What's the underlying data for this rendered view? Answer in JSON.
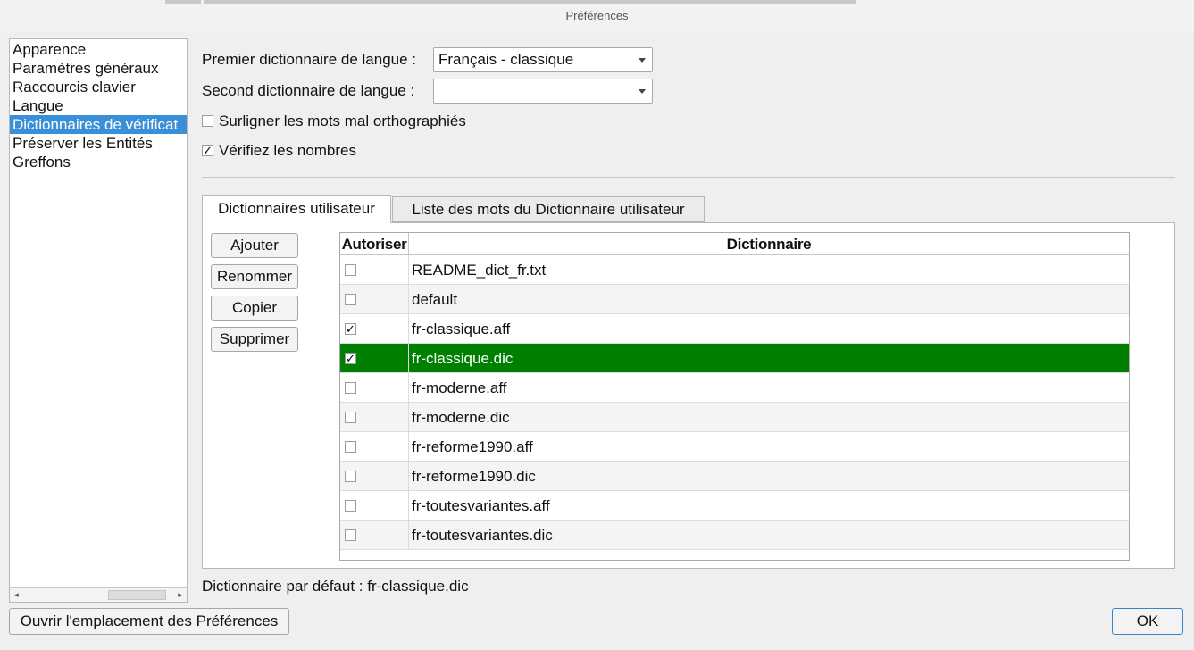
{
  "window": {
    "title": "Préférences"
  },
  "sidebar": {
    "items": [
      {
        "label": "Apparence",
        "selected": false
      },
      {
        "label": "Paramètres généraux",
        "selected": false
      },
      {
        "label": "Raccourcis clavier",
        "selected": false
      },
      {
        "label": "Langue",
        "selected": false
      },
      {
        "label": "Dictionnaires de vérificat",
        "selected": true
      },
      {
        "label": "Préserver les Entités",
        "selected": false
      },
      {
        "label": "Greffons",
        "selected": false
      }
    ],
    "scroll_left_arrow": "◂",
    "scroll_right_arrow": "▸"
  },
  "form": {
    "primary_label": "Premier dictionnaire de langue :",
    "primary_value": "Français - classique",
    "secondary_label": "Second dictionnaire de langue :",
    "secondary_value": "",
    "highlight_label": "Surligner les mots mal orthographiés",
    "highlight_checked": false,
    "numbers_label": "Vérifiez les nombres",
    "numbers_checked": true
  },
  "tabs": [
    {
      "label": "Dictionnaires utilisateur",
      "active": true
    },
    {
      "label": "Liste des mots du Dictionnaire utilisateur",
      "active": false
    }
  ],
  "buttons": {
    "add": "Ajouter",
    "rename": "Renommer",
    "copy": "Copier",
    "delete": "Supprimer"
  },
  "table": {
    "columns": [
      "Autoriser",
      "Dictionnaire"
    ],
    "rows": [
      {
        "enabled": false,
        "name": "README_dict_fr.txt",
        "selected": false
      },
      {
        "enabled": false,
        "name": "default",
        "selected": false
      },
      {
        "enabled": true,
        "name": "fr-classique.aff",
        "selected": false
      },
      {
        "enabled": true,
        "name": "fr-classique.dic",
        "selected": true
      },
      {
        "enabled": false,
        "name": "fr-moderne.aff",
        "selected": false
      },
      {
        "enabled": false,
        "name": "fr-moderne.dic",
        "selected": false
      },
      {
        "enabled": false,
        "name": "fr-reforme1990.aff",
        "selected": false
      },
      {
        "enabled": false,
        "name": "fr-reforme1990.dic",
        "selected": false
      },
      {
        "enabled": false,
        "name": "fr-toutesvariantes.aff",
        "selected": false
      },
      {
        "enabled": false,
        "name": "fr-toutesvariantes.dic",
        "selected": false
      }
    ]
  },
  "status": {
    "default_dict": "Dictionnaire par défaut : fr-classique.dic"
  },
  "footer": {
    "open_prefs": "Ouvrir l'emplacement des Préférences",
    "ok": "OK"
  },
  "colors": {
    "selection_blue": "#3a8fd9",
    "row_selected_green": "#008000"
  }
}
